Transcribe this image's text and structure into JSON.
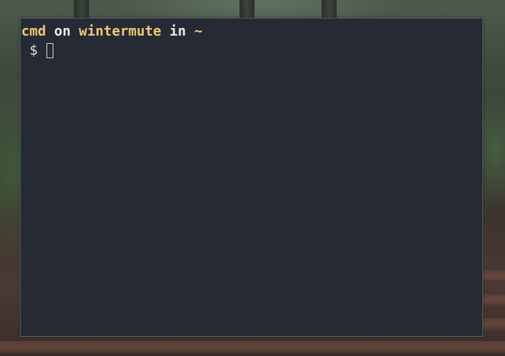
{
  "terminal": {
    "prompt_line": {
      "user": "cmd",
      "on_word": " on ",
      "host": "wintermute",
      "in_word": " in ",
      "cwd": "~"
    },
    "input_line": {
      "prompt_symbol": " $ ",
      "current_input": ""
    }
  },
  "colors": {
    "terminal_background": "#252a34",
    "highlight_text": "#f0c674",
    "plain_text": "#e8e8e8",
    "window_border": "#5f6670"
  }
}
